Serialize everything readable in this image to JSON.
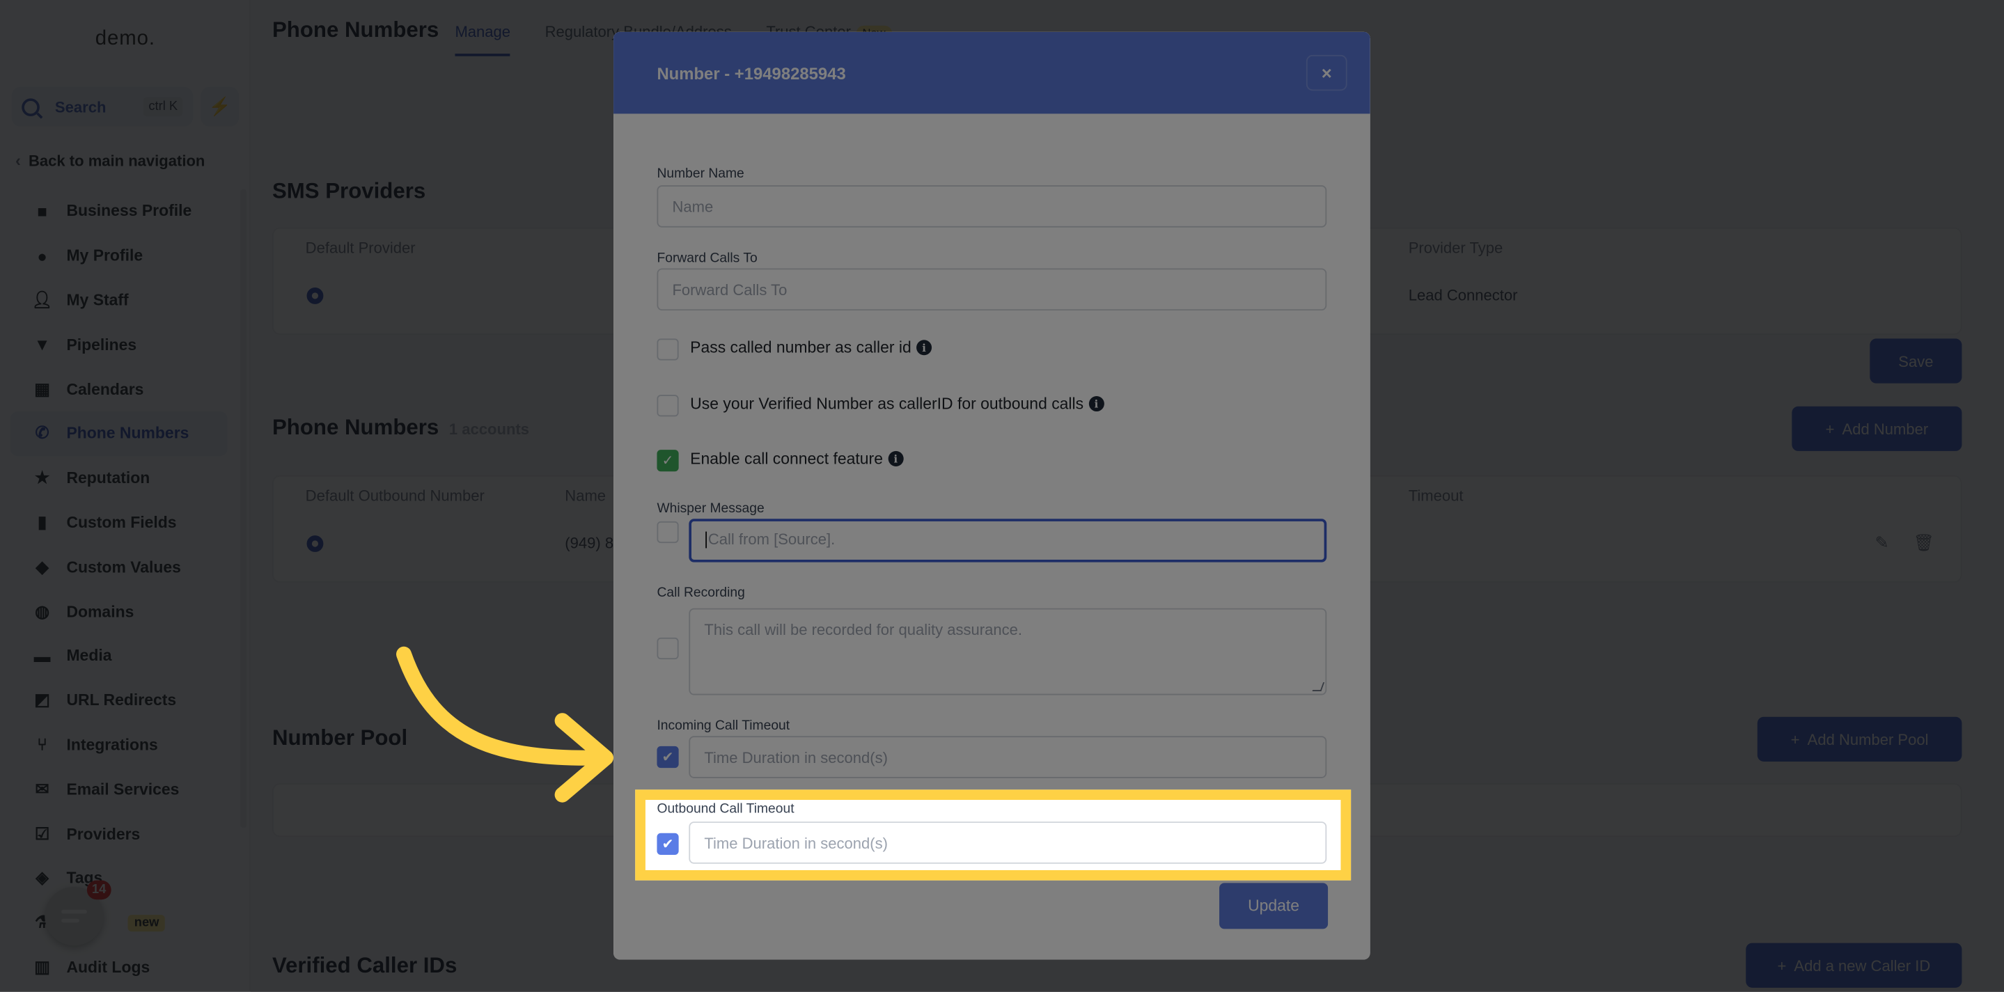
{
  "sidebar": {
    "logo": "demo.",
    "search": {
      "label": "Search",
      "shortcut": "ctrl K"
    },
    "back_label": "Back to main navigation",
    "items": [
      {
        "label": "Business Profile",
        "icon": "briefcase-icon"
      },
      {
        "label": "My Profile",
        "icon": "user-circle-icon"
      },
      {
        "label": "My Staff",
        "icon": "user-icon"
      },
      {
        "label": "Pipelines",
        "icon": "funnel-icon"
      },
      {
        "label": "Calendars",
        "icon": "calendar-icon"
      },
      {
        "label": "Phone Numbers",
        "icon": "phone-icon",
        "active": true
      },
      {
        "label": "Reputation",
        "icon": "star-icon"
      },
      {
        "label": "Custom Fields",
        "icon": "custom-fields-icon"
      },
      {
        "label": "Custom Values",
        "icon": "gem-icon"
      },
      {
        "label": "Domains",
        "icon": "globe-icon"
      },
      {
        "label": "Media",
        "icon": "media-icon"
      },
      {
        "label": "URL Redirects",
        "icon": "redirect-icon"
      },
      {
        "label": "Integrations",
        "icon": "integrations-icon"
      },
      {
        "label": "Email Services",
        "icon": "mail-icon"
      },
      {
        "label": "Providers",
        "icon": "clipboard-check-icon"
      },
      {
        "label": "Tags",
        "icon": "tag-icon"
      },
      {
        "label": "",
        "icon": "flask-icon",
        "badge": "new"
      },
      {
        "label": "Audit Logs",
        "icon": "bar-chart-icon"
      }
    ],
    "chat_widget": {
      "count": "14"
    }
  },
  "header": {
    "title": "Phone Numbers",
    "tabs": [
      {
        "label": "Manage",
        "active": true
      },
      {
        "label": "Regulatory Bundle/Address"
      },
      {
        "label": "Trust Center",
        "badge": "New"
      }
    ]
  },
  "sms_providers": {
    "title": "SMS Providers",
    "columns": [
      "Default Provider",
      "Provider Type"
    ],
    "row": {
      "provider_type": "Lead Connector"
    },
    "save_label": "Save"
  },
  "phone_numbers": {
    "title": "Phone Numbers",
    "count_label": "1 accounts",
    "add_label": "Add Number",
    "columns": [
      "Default Outbound Number",
      "Name",
      "Timeout"
    ],
    "row": {
      "name": "(949) 8"
    }
  },
  "number_pool": {
    "title": "Number Pool",
    "add_label": "Add Number Pool"
  },
  "verified_caller_ids": {
    "title": "Verified Caller IDs",
    "add_label": "Add a new Caller ID"
  },
  "modal": {
    "title": "Number - +19498285943",
    "close_label": "×",
    "number_name": {
      "label": "Number Name",
      "placeholder": "Name"
    },
    "forward_calls": {
      "label": "Forward Calls To",
      "placeholder": "Forward Calls To"
    },
    "pass_called_number": {
      "label": "Pass called number as caller id",
      "checked": false
    },
    "use_verified_number": {
      "label": "Use your Verified Number as callerID for outbound calls",
      "checked": false
    },
    "call_connect": {
      "label": "Enable call connect feature",
      "checked": true
    },
    "whisper_message": {
      "label": "Whisper Message",
      "placeholder": "Call from [Source].",
      "checked": false
    },
    "call_recording": {
      "label": "Call Recording",
      "placeholder": "This call will be recorded for quality assurance.",
      "checked": false
    },
    "incoming_timeout": {
      "label": "Incoming Call Timeout",
      "placeholder": "Time Duration in second(s)",
      "checked": true
    },
    "outbound_timeout": {
      "label": "Outbound Call Timeout",
      "placeholder": "Time Duration in second(s)",
      "checked": true
    },
    "update_label": "Update"
  },
  "annotation": {
    "highlight_color": "#fed145",
    "target": "Outbound Call Timeout"
  }
}
